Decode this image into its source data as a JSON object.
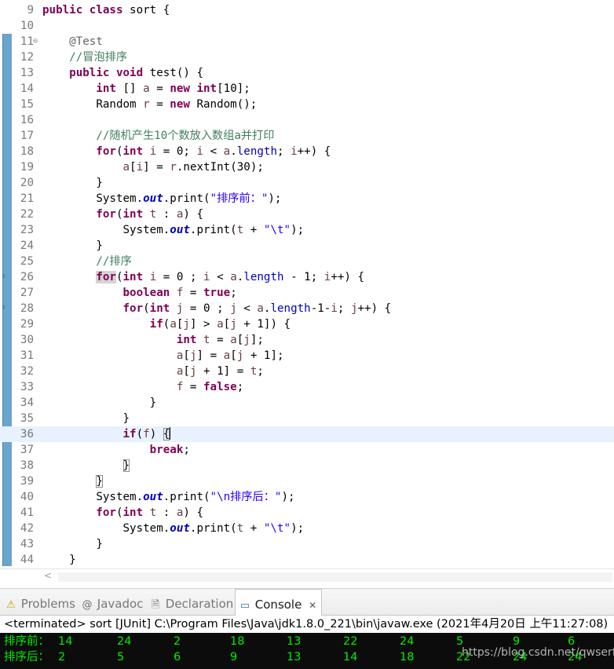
{
  "editor": {
    "lines": [
      {
        "n": "9",
        "parts": [
          {
            "t": "public class ",
            "c": "kw"
          },
          {
            "t": "sort {"
          }
        ]
      },
      {
        "n": "10",
        "parts": []
      },
      {
        "n": "11",
        "fold": "⊖",
        "parts": [
          {
            "t": "    "
          },
          {
            "t": "@Test",
            "c": "ann"
          }
        ]
      },
      {
        "n": "12",
        "parts": [
          {
            "t": "    "
          },
          {
            "t": "//冒泡排序",
            "c": "cm"
          }
        ]
      },
      {
        "n": "13",
        "parts": [
          {
            "t": "    "
          },
          {
            "t": "public void ",
            "c": "kw"
          },
          {
            "t": "test() {"
          }
        ]
      },
      {
        "n": "14",
        "parts": [
          {
            "t": "        "
          },
          {
            "t": "int ",
            "c": "kw"
          },
          {
            "t": "[] "
          },
          {
            "t": "a",
            "c": "var"
          },
          {
            "t": " = "
          },
          {
            "t": "new int",
            "c": "kw"
          },
          {
            "t": "[10];"
          }
        ]
      },
      {
        "n": "15",
        "parts": [
          {
            "t": "        Random "
          },
          {
            "t": "r",
            "c": "var"
          },
          {
            "t": " = "
          },
          {
            "t": "new ",
            "c": "kw"
          },
          {
            "t": "Random();"
          }
        ]
      },
      {
        "n": "16",
        "parts": []
      },
      {
        "n": "17",
        "parts": [
          {
            "t": "        "
          },
          {
            "t": "//随机产生10个数放入数组a并打印",
            "c": "cm"
          }
        ]
      },
      {
        "n": "18",
        "parts": [
          {
            "t": "        "
          },
          {
            "t": "for",
            "c": "kw"
          },
          {
            "t": "("
          },
          {
            "t": "int ",
            "c": "kw"
          },
          {
            "t": "i",
            "c": "var"
          },
          {
            "t": " = 0; "
          },
          {
            "t": "i",
            "c": "var"
          },
          {
            "t": " < "
          },
          {
            "t": "a",
            "c": "var"
          },
          {
            "t": "."
          },
          {
            "t": "length",
            "c": "fld"
          },
          {
            "t": "; "
          },
          {
            "t": "i",
            "c": "var"
          },
          {
            "t": "++) {"
          }
        ]
      },
      {
        "n": "19",
        "parts": [
          {
            "t": "            "
          },
          {
            "t": "a",
            "c": "var"
          },
          {
            "t": "["
          },
          {
            "t": "i",
            "c": "var"
          },
          {
            "t": "] = "
          },
          {
            "t": "r",
            "c": "var"
          },
          {
            "t": ".nextInt(30);"
          }
        ]
      },
      {
        "n": "20",
        "parts": [
          {
            "t": "        }"
          }
        ]
      },
      {
        "n": "21",
        "parts": [
          {
            "t": "        System."
          },
          {
            "t": "out",
            "c": "sfld"
          },
          {
            "t": ".print("
          },
          {
            "t": "\"排序前：\"",
            "c": "str"
          },
          {
            "t": ");"
          }
        ]
      },
      {
        "n": "22",
        "parts": [
          {
            "t": "        "
          },
          {
            "t": "for",
            "c": "kw"
          },
          {
            "t": "("
          },
          {
            "t": "int ",
            "c": "kw"
          },
          {
            "t": "t",
            "c": "var"
          },
          {
            "t": " : "
          },
          {
            "t": "a",
            "c": "var"
          },
          {
            "t": ") {"
          }
        ]
      },
      {
        "n": "23",
        "parts": [
          {
            "t": "            System."
          },
          {
            "t": "out",
            "c": "sfld"
          },
          {
            "t": ".print("
          },
          {
            "t": "t",
            "c": "var"
          },
          {
            "t": " + "
          },
          {
            "t": "\"\\t\"",
            "c": "str"
          },
          {
            "t": ");"
          }
        ]
      },
      {
        "n": "24",
        "parts": [
          {
            "t": "        }"
          }
        ]
      },
      {
        "n": "25",
        "parts": [
          {
            "t": "        "
          },
          {
            "t": "//排序",
            "c": "cm"
          }
        ]
      },
      {
        "n": "26",
        "mark": "⇕",
        "parts": [
          {
            "t": "        "
          },
          {
            "t": "for",
            "c": "kw hl"
          },
          {
            "t": "("
          },
          {
            "t": "int ",
            "c": "kw"
          },
          {
            "t": "i",
            "c": "var"
          },
          {
            "t": " = 0 ; "
          },
          {
            "t": "i",
            "c": "var"
          },
          {
            "t": " < "
          },
          {
            "t": "a",
            "c": "var"
          },
          {
            "t": "."
          },
          {
            "t": "length",
            "c": "fld"
          },
          {
            "t": " - 1; "
          },
          {
            "t": "i",
            "c": "var"
          },
          {
            "t": "++) {"
          }
        ]
      },
      {
        "n": "27",
        "parts": [
          {
            "t": "            "
          },
          {
            "t": "boolean ",
            "c": "kw"
          },
          {
            "t": "f",
            "c": "var"
          },
          {
            "t": " = "
          },
          {
            "t": "true",
            "c": "kw"
          },
          {
            "t": ";"
          }
        ]
      },
      {
        "n": "28",
        "mark": "⇕",
        "parts": [
          {
            "t": "            "
          },
          {
            "t": "for",
            "c": "kw"
          },
          {
            "t": "("
          },
          {
            "t": "int ",
            "c": "kw"
          },
          {
            "t": "j",
            "c": "var"
          },
          {
            "t": " = 0 ; "
          },
          {
            "t": "j",
            "c": "var"
          },
          {
            "t": " < "
          },
          {
            "t": "a",
            "c": "var"
          },
          {
            "t": "."
          },
          {
            "t": "length",
            "c": "fld"
          },
          {
            "t": "-1-"
          },
          {
            "t": "i",
            "c": "var"
          },
          {
            "t": "; "
          },
          {
            "t": "j",
            "c": "var"
          },
          {
            "t": "++) {"
          }
        ]
      },
      {
        "n": "29",
        "parts": [
          {
            "t": "                "
          },
          {
            "t": "if",
            "c": "kw"
          },
          {
            "t": "("
          },
          {
            "t": "a",
            "c": "var"
          },
          {
            "t": "["
          },
          {
            "t": "j",
            "c": "var"
          },
          {
            "t": "] > "
          },
          {
            "t": "a",
            "c": "var"
          },
          {
            "t": "["
          },
          {
            "t": "j",
            "c": "var"
          },
          {
            "t": " + 1]) {"
          }
        ]
      },
      {
        "n": "30",
        "parts": [
          {
            "t": "                    "
          },
          {
            "t": "int ",
            "c": "kw"
          },
          {
            "t": "t",
            "c": "var"
          },
          {
            "t": " = "
          },
          {
            "t": "a",
            "c": "var"
          },
          {
            "t": "["
          },
          {
            "t": "j",
            "c": "var"
          },
          {
            "t": "];"
          }
        ]
      },
      {
        "n": "31",
        "parts": [
          {
            "t": "                    "
          },
          {
            "t": "a",
            "c": "var"
          },
          {
            "t": "["
          },
          {
            "t": "j",
            "c": "var"
          },
          {
            "t": "] = "
          },
          {
            "t": "a",
            "c": "var"
          },
          {
            "t": "["
          },
          {
            "t": "j",
            "c": "var"
          },
          {
            "t": " + 1];"
          }
        ]
      },
      {
        "n": "32",
        "parts": [
          {
            "t": "                    "
          },
          {
            "t": "a",
            "c": "var"
          },
          {
            "t": "["
          },
          {
            "t": "j",
            "c": "var"
          },
          {
            "t": " + 1] = "
          },
          {
            "t": "t",
            "c": "var"
          },
          {
            "t": ";"
          }
        ]
      },
      {
        "n": "33",
        "parts": [
          {
            "t": "                    "
          },
          {
            "t": "f",
            "c": "var"
          },
          {
            "t": " = "
          },
          {
            "t": "false",
            "c": "kw"
          },
          {
            "t": ";"
          }
        ]
      },
      {
        "n": "34",
        "parts": [
          {
            "t": "                }"
          }
        ]
      },
      {
        "n": "35",
        "parts": [
          {
            "t": "            }"
          }
        ]
      },
      {
        "n": "36",
        "current": true,
        "parts": [
          {
            "t": "            "
          },
          {
            "t": "if",
            "c": "kw"
          },
          {
            "t": "("
          },
          {
            "t": "f",
            "c": "var"
          },
          {
            "t": ") "
          },
          {
            "t": "{",
            "c": "box"
          },
          {
            "t": "",
            "c": "caret"
          }
        ]
      },
      {
        "n": "37",
        "parts": [
          {
            "t": "                "
          },
          {
            "t": "break",
            "c": "kw"
          },
          {
            "t": ";"
          }
        ]
      },
      {
        "n": "38",
        "parts": [
          {
            "t": "            "
          },
          {
            "t": "}",
            "c": "box"
          }
        ]
      },
      {
        "n": "39",
        "parts": [
          {
            "t": "        "
          },
          {
            "t": "}",
            "c": "box"
          }
        ]
      },
      {
        "n": "40",
        "parts": [
          {
            "t": "        System."
          },
          {
            "t": "out",
            "c": "sfld"
          },
          {
            "t": ".print("
          },
          {
            "t": "\"\\n排序后：\"",
            "c": "str"
          },
          {
            "t": ");"
          }
        ]
      },
      {
        "n": "41",
        "parts": [
          {
            "t": "        "
          },
          {
            "t": "for",
            "c": "kw"
          },
          {
            "t": "("
          },
          {
            "t": "int ",
            "c": "kw"
          },
          {
            "t": "t",
            "c": "var"
          },
          {
            "t": " : "
          },
          {
            "t": "a",
            "c": "var"
          },
          {
            "t": ") {"
          }
        ]
      },
      {
        "n": "42",
        "parts": [
          {
            "t": "            System."
          },
          {
            "t": "out",
            "c": "sfld"
          },
          {
            "t": ".print("
          },
          {
            "t": "t",
            "c": "var"
          },
          {
            "t": " + "
          },
          {
            "t": "\"\\t\"",
            "c": "str"
          },
          {
            "t": ");"
          }
        ]
      },
      {
        "n": "43",
        "parts": [
          {
            "t": "        }"
          }
        ]
      },
      {
        "n": "44",
        "parts": [
          {
            "t": "    }"
          }
        ]
      }
    ]
  },
  "scrollbar": {
    "left_arrow": "<"
  },
  "tabs": [
    {
      "label": "Problems",
      "icon": "problems-icon",
      "glyph": "⚠",
      "active": false
    },
    {
      "label": "Javadoc",
      "icon": "javadoc-icon",
      "glyph": "@",
      "active": false
    },
    {
      "label": "Declaration",
      "icon": "declaration-icon",
      "glyph": "🗎",
      "active": false
    },
    {
      "label": "Console",
      "icon": "console-icon",
      "glyph": "▭",
      "active": true,
      "close": "✕"
    }
  ],
  "console": {
    "status": "<terminated> sort [JUnit] C:\\Program Files\\Java\\jdk1.8.0_221\\bin\\javaw.exe (2021年4月20日 上午11:27:08)",
    "rows": [
      {
        "label": "排序前：",
        "values": [
          "14",
          "24",
          "2",
          "18",
          "13",
          "22",
          "24",
          "5",
          "9",
          "6"
        ]
      },
      {
        "label": "排序后：",
        "values": [
          "2",
          "5",
          "6",
          "9",
          "13",
          "14",
          "18",
          "22",
          "24",
          "24"
        ]
      }
    ],
    "watermark": "https://blog.csdn.net/qwserft"
  },
  "colors": {
    "keyword": "#7f0055",
    "comment": "#3f7f5f",
    "string": "#2a00ff",
    "field": "#0000c0",
    "console_text": "#00ee00",
    "console_bg": "#0c0c0c",
    "current_line": "#e8f2fe"
  }
}
